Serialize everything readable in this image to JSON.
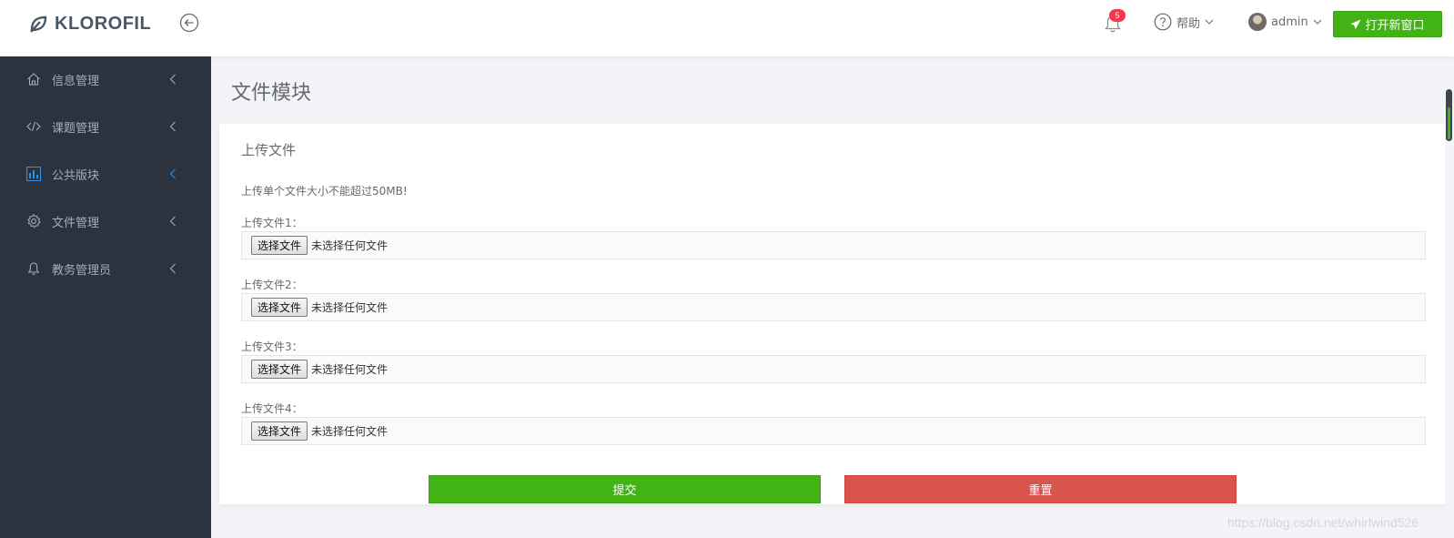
{
  "brand": {
    "name": "KLOROFIL"
  },
  "navbar": {
    "notification_count": "5",
    "help_label": "帮助",
    "user_name": "admin",
    "open_window_label": "打开新窗口"
  },
  "sidebar": {
    "items": [
      {
        "label": "信息管理",
        "icon": "home-icon"
      },
      {
        "label": "课题管理",
        "icon": "code-icon"
      },
      {
        "label": "公共版块",
        "icon": "bar-chart-icon",
        "active": true
      },
      {
        "label": "文件管理",
        "icon": "gear-icon"
      },
      {
        "label": "教务管理员",
        "icon": "bell-icon"
      }
    ]
  },
  "main": {
    "page_title": "文件模块",
    "panel_title": "上传文件",
    "note": "上传单个文件大小不能超过50MB!",
    "fields": [
      {
        "label": "上传文件1：",
        "button": "选择文件",
        "status": "未选择任何文件"
      },
      {
        "label": "上传文件2：",
        "button": "选择文件",
        "status": "未选择任何文件"
      },
      {
        "label": "上传文件3：",
        "button": "选择文件",
        "status": "未选择任何文件"
      },
      {
        "label": "上传文件4：",
        "button": "选择文件",
        "status": "未选择任何文件"
      }
    ],
    "submit_label": "提交",
    "reset_label": "重置"
  },
  "watermark": "https://blog.csdn.net/whirlwind526",
  "colors": {
    "accent_green": "#41b314",
    "danger_red": "#d9534f",
    "sidebar_bg": "#2b333e",
    "active_blue": "#2e90e8",
    "badge_red": "#f9354c"
  }
}
